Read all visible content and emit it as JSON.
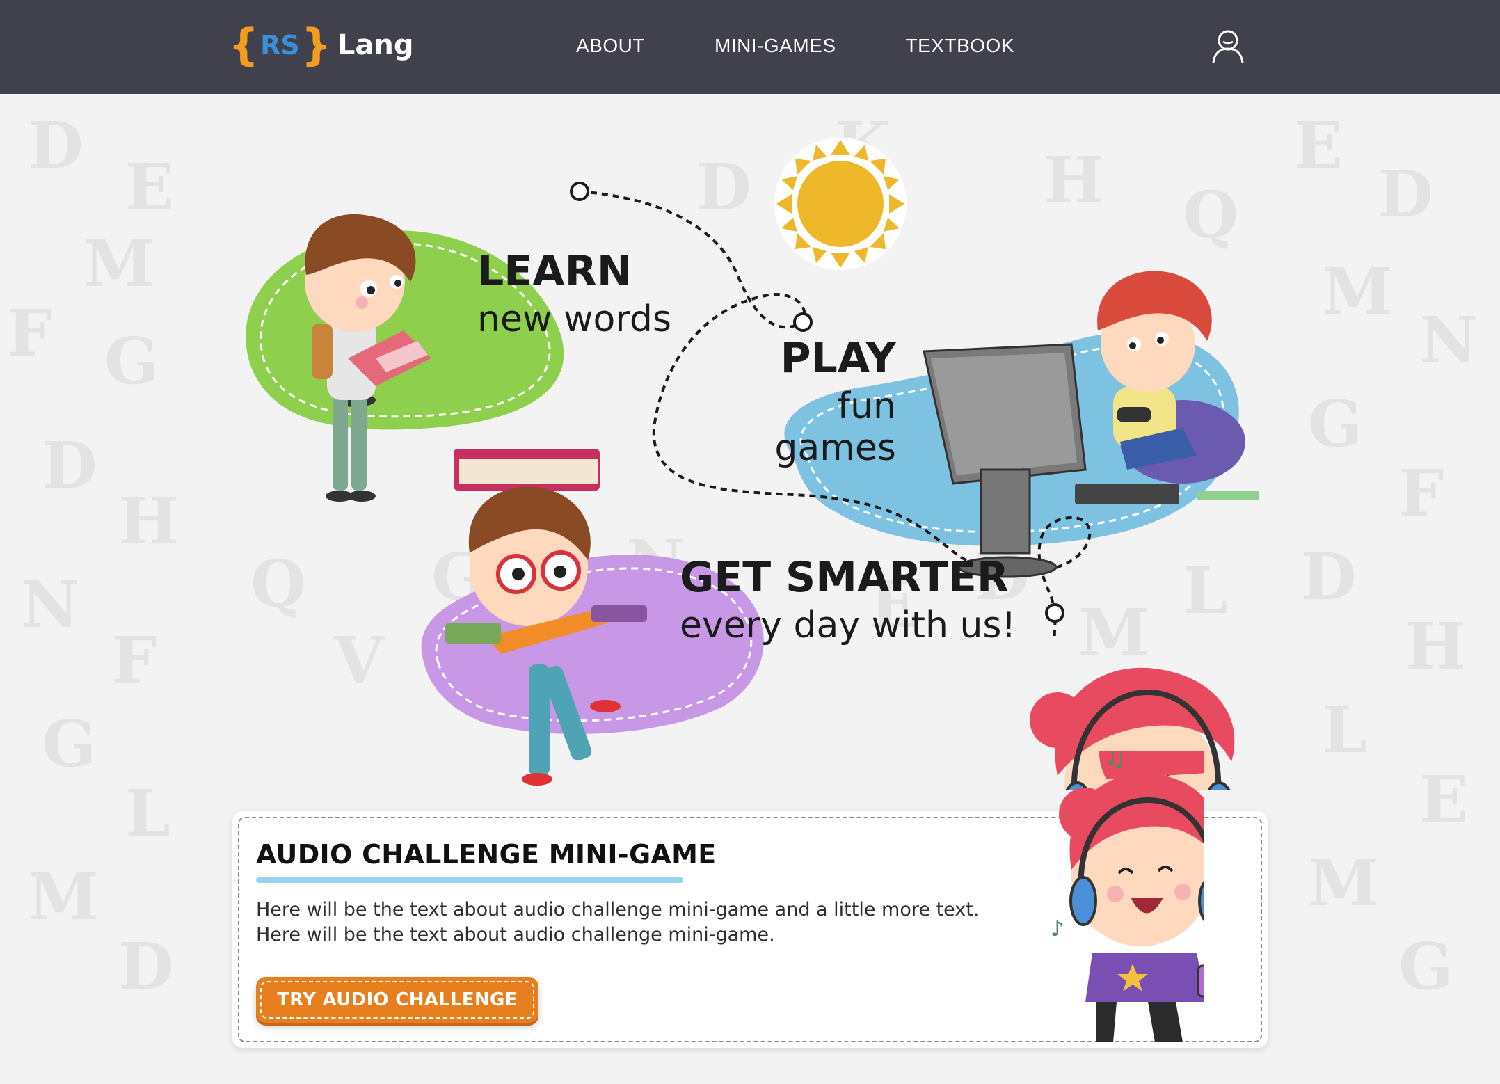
{
  "header": {
    "logo": {
      "brace_left": "{",
      "rs": "RS",
      "brace_right": "}",
      "lang": "Lang"
    },
    "nav": [
      "ABOUT",
      "MINI-GAMES",
      "TEXTBOOK"
    ],
    "user_icon": "user-icon"
  },
  "hero": {
    "learn": {
      "title": "LEARN",
      "subtitle": "new words"
    },
    "play": {
      "title": "PLAY",
      "subtitle": "fun games"
    },
    "smarter": {
      "title": "GET SMARTER",
      "subtitle": "every day with us!"
    }
  },
  "card": {
    "title": "AUDIO CHALLENGE MINI-GAME",
    "text": "Here will be the text about audio challenge mini-game and a little more text. Here will be the text about audio challenge mini-game.",
    "button": "TRY AUDIO CHALLENGE"
  },
  "colors": {
    "header_bg": "#41414e",
    "green_blob": "#8ecf4e",
    "blue_blob": "#7ec2e2",
    "purple_blob": "#c898e6",
    "accent_orange": "#e87f1f",
    "logo_blue": "#3a8fd8"
  }
}
